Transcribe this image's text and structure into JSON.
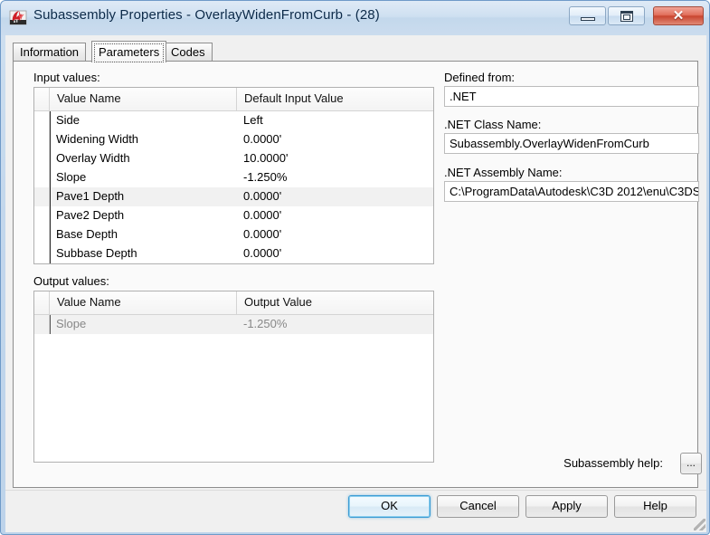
{
  "window": {
    "title": "Subassembly Properties - OverlayWidenFromCurb - (28)",
    "icon": "autocad-subassembly-icon",
    "minimize_label": "",
    "maximize_label": "",
    "close_label": "✕"
  },
  "tabs": [
    {
      "label": "Information",
      "selected": false
    },
    {
      "label": "Parameters",
      "selected": true
    },
    {
      "label": "Codes",
      "selected": false
    }
  ],
  "sections": {
    "input_label": "Input values:",
    "output_label": "Output values:"
  },
  "input_table": {
    "columns": [
      "Value Name",
      "Default Input Value"
    ],
    "rows": [
      {
        "name": "Side",
        "value": "Left",
        "highlight": false
      },
      {
        "name": "Widening Width",
        "value": "0.0000'",
        "highlight": false
      },
      {
        "name": "Overlay Width",
        "value": "10.0000'",
        "highlight": false
      },
      {
        "name": "Slope",
        "value": "-1.250%",
        "highlight": false
      },
      {
        "name": "Pave1 Depth",
        "value": "0.0000'",
        "highlight": true
      },
      {
        "name": "Pave2 Depth",
        "value": "0.0000'",
        "highlight": false
      },
      {
        "name": "Base Depth",
        "value": "0.0000'",
        "highlight": false
      },
      {
        "name": "Subbase Depth",
        "value": "0.0000'",
        "highlight": false
      }
    ]
  },
  "output_table": {
    "columns": [
      "Value Name",
      "Output Value"
    ],
    "rows": [
      {
        "name": "Slope",
        "value": "-1.250%",
        "highlight": true,
        "disabled": true
      }
    ]
  },
  "right_panel": {
    "defined_from_label": "Defined from:",
    "defined_from_value": ".NET",
    "class_name_label": ".NET Class Name:",
    "class_name_value": "Subassembly.OverlayWidenFromCurb",
    "assembly_name_label": ".NET Assembly Name:",
    "assembly_name_value": "C:\\ProgramData\\Autodesk\\C3D 2012\\enu\\C3DS"
  },
  "help": {
    "label": "Subassembly help:",
    "button_label": "..."
  },
  "buttons": {
    "ok": "OK",
    "cancel": "Cancel",
    "apply": "Apply",
    "help": "Help"
  },
  "colors": {
    "titlebar_text": "#0c2a49",
    "close_button": "#c9452f",
    "default_button_border": "#3c9cd4",
    "row_highlight": "#f1f1f1",
    "disabled_text": "#888888"
  }
}
